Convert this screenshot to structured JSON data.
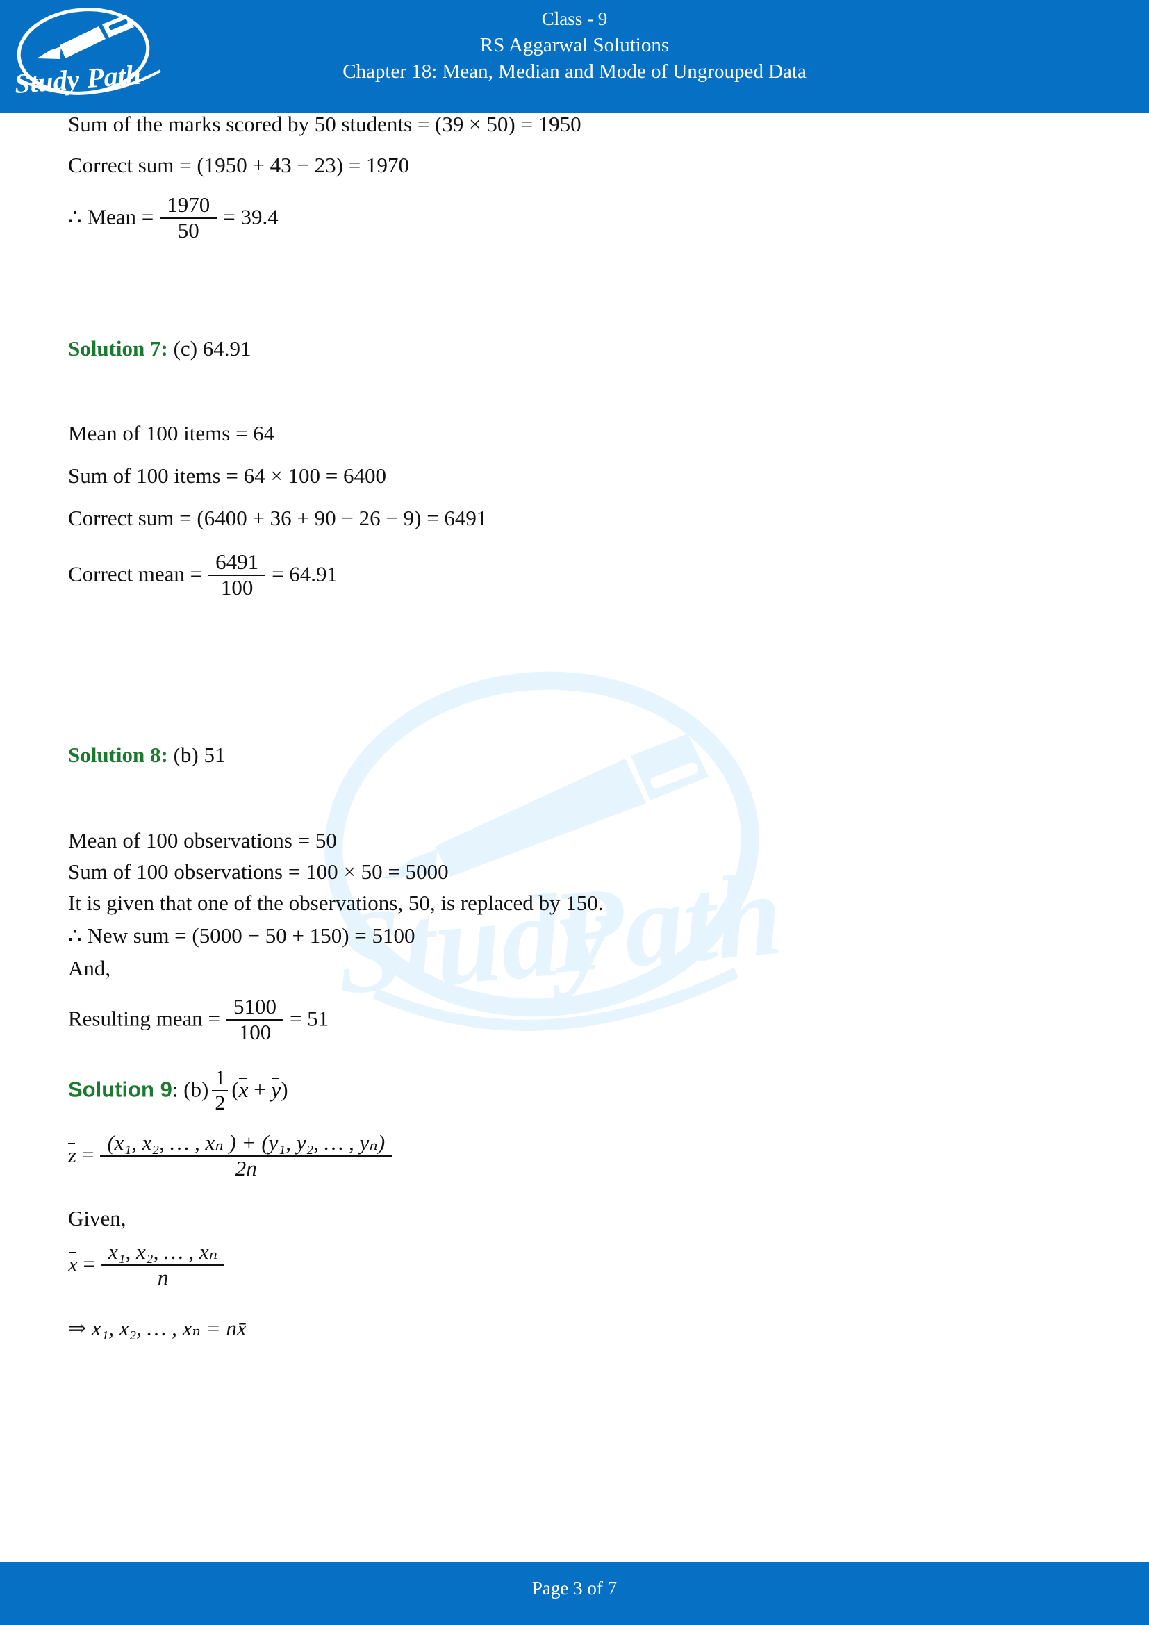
{
  "header": {
    "logo_text": "Study Path",
    "logo_icon": "fountain-pen-icon",
    "line1": "Class - 9",
    "line2": "RS Aggarwal Solutions",
    "line3": "Chapter 18: Mean, Median and Mode of Ungrouped Data",
    "bg_color": "#0670c4"
  },
  "watermark": {
    "text": "Study Path",
    "color": "#e9f6fd"
  },
  "body": {
    "l1": "Sum of the marks scored by 50 students = (39 × 50) = 1950",
    "l2": "Correct sum = (1950 + 43 − 23) = 1970",
    "mean_prefix": "∴ Mean =",
    "mean_num": "1970",
    "mean_den": "50",
    "mean_result": "= 39.4",
    "sol7_label": "Solution 7:",
    "sol7_answer": "(c) 64.91",
    "sol7_l1": "Mean of 100 items = 64",
    "sol7_l2": "Sum of 100 items = 64 × 100 = 6400",
    "sol7_l3": "Correct sum = (6400 + 36 + 90 − 26 − 9) = 6491",
    "sol7_mean_prefix": "Correct mean =",
    "sol7_mean_num": "6491",
    "sol7_mean_den": "100",
    "sol7_mean_result": "= 64.91",
    "sol8_label": "Solution 8:",
    "sol8_answer": "(b) 51",
    "sol8_l1": "Mean of 100 observations = 50",
    "sol8_l2": "Sum of 100 observations = 100 × 50 = 5000",
    "sol8_l3": "It is given that one of the observations, 50, is replaced by 150.",
    "sol8_l4": "∴ New sum = (5000 − 50 + 150) = 5100",
    "sol8_l5": "And,",
    "sol8_mean_prefix": "Resulting mean =",
    "sol8_mean_num": "5100",
    "sol8_mean_den": "100",
    "sol8_mean_result": "= 51",
    "sol9_label": "Solution 9",
    "sol9_colon": ": (b)",
    "sol9_frac_num": "1",
    "sol9_frac_den": "2",
    "sol9_expr_open": "(",
    "sol9_x": "x",
    "sol9_plus": "+",
    "sol9_y": "y",
    "sol9_expr_close": ")",
    "zbar_lhs": "z",
    "zbar_eq": "=",
    "zbar_num": "(x₁, x₂, … , xₙ ) + (y₁, y₂, … , yₙ)",
    "zbar_den": "2n",
    "given_label": "Given,",
    "xbar_lhs": "x",
    "xbar_eq": "=",
    "xbar_num": "x₁, x₂, … , xₙ",
    "xbar_den": "n",
    "implies_line": "⇒ x₁, x₂, … , xₙ = nx̄"
  },
  "footer": {
    "page_prefix": "Page",
    "page_current": "3",
    "page_of": "of",
    "page_total": "7",
    "bg_color": "#0670c4"
  }
}
